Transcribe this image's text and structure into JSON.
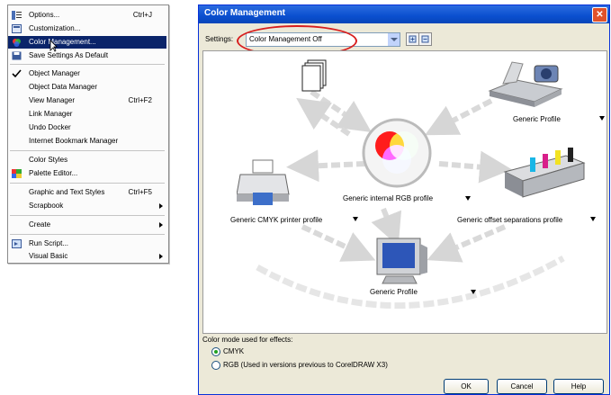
{
  "menu": {
    "items": [
      {
        "label": "Options...",
        "shortcut": "Ctrl+J",
        "icon": "options-icon"
      },
      {
        "label": "Customization...",
        "shortcut": "",
        "icon": "customization-icon"
      },
      {
        "label": "Color Management...",
        "shortcut": "",
        "icon": "color-management-icon",
        "highlighted": true
      },
      {
        "label": "Save Settings As Default",
        "shortcut": "",
        "icon": "save-settings-icon"
      },
      {
        "label": "Object Manager",
        "shortcut": "",
        "icon": "checkmark-icon"
      },
      {
        "label": "Object Data Manager",
        "shortcut": ""
      },
      {
        "label": "View Manager",
        "shortcut": "Ctrl+F2"
      },
      {
        "label": "Link Manager",
        "shortcut": ""
      },
      {
        "label": "Undo Docker",
        "shortcut": ""
      },
      {
        "label": "Internet Bookmark Manager",
        "shortcut": ""
      },
      {
        "label": "Color Styles",
        "shortcut": ""
      },
      {
        "label": "Palette Editor...",
        "shortcut": "",
        "icon": "palette-editor-icon"
      },
      {
        "label": "Graphic and Text Styles",
        "shortcut": "Ctrl+F5"
      },
      {
        "label": "Scrapbook",
        "shortcut": "",
        "submenu": true
      },
      {
        "label": "Create",
        "shortcut": "",
        "submenu": true
      },
      {
        "label": "Run Script...",
        "shortcut": "",
        "icon": "run-script-icon"
      },
      {
        "label": "Visual Basic",
        "shortcut": "",
        "submenu": true
      }
    ]
  },
  "dialog": {
    "title": "Color Management",
    "settings_label": "Settings:",
    "settings_value": "Color Management Off",
    "profiles": {
      "internal_rgb": "Generic internal RGB profile",
      "scanner": "Generic Profile",
      "printer": "Generic CMYK printer profile",
      "separations": "Generic offset separations profile",
      "monitor": "Generic Profile"
    },
    "mode_label": "Color mode used for effects:",
    "radio_cmyk": "CMYK",
    "radio_rgb": "RGB (Used in versions previous to CorelDRAW X3)",
    "buttons": {
      "ok": "OK",
      "cancel": "Cancel",
      "help": "Help"
    }
  },
  "colors": {
    "titlebar": "#0a4fcf",
    "highlight": "#0a246a",
    "annotation_oval": "#d81e1e"
  }
}
